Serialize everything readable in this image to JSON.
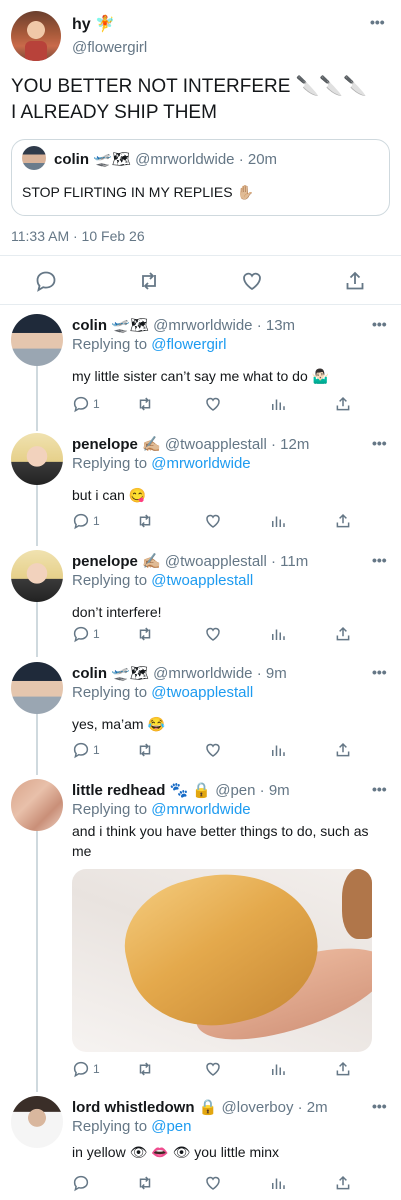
{
  "main_tweet": {
    "name": "hy",
    "name_emoji": "🧚",
    "handle": "@flowergirl",
    "more": "•••",
    "text": "YOU BETTER NOT INTERFERE 🔪🔪🔪\nI ALREADY SHIP THEM",
    "quote": {
      "name": "colin",
      "name_emoji": "🛫🗺",
      "handle": "@mrworldwide",
      "time": "· 20m",
      "text": "STOP FLIRTING IN MY REPLIES ✋🏼"
    },
    "timestamp": "11:33 AM · 10 Feb 26"
  },
  "replies": [
    {
      "name": "colin",
      "name_emoji": "🛫🗺",
      "handle": "@mrworldwide",
      "time": "· 13m",
      "replying_label": "Replying to",
      "replying_to": "@flowergirl",
      "text": "my little sister can’t say me what to do 🤷🏻‍♂️",
      "reply_count": "1",
      "more": "•••"
    },
    {
      "name": "penelope",
      "name_emoji": "✍🏼",
      "handle": "@twoapplestall",
      "time": "· 12m",
      "replying_label": "Replying to",
      "replying_to": "@mrworldwide",
      "text": "but i can 😋",
      "reply_count": "1",
      "more": "•••"
    },
    {
      "name": "penelope",
      "name_emoji": "✍🏼",
      "handle": "@twoapplestall",
      "time": "· 11m",
      "replying_label": "Replying to",
      "replying_to": "@twoapplestall",
      "text": "don’t interfere!",
      "reply_count": "1",
      "more": "•••"
    },
    {
      "name": "colin",
      "name_emoji": "🛫🗺",
      "handle": "@mrworldwide",
      "time": "· 9m",
      "replying_label": "Replying to",
      "replying_to": "@twoapplestall",
      "text": "yes, ma’am 😂",
      "reply_count": "1",
      "more": "•••"
    },
    {
      "name": "little redhead",
      "name_emoji": "🐾 🔒",
      "handle": "@pen",
      "time": "· 9m",
      "replying_label": "Replying to",
      "replying_to": "@mrworldwide",
      "text": "and i think you have better things to do, such as me",
      "reply_count": "1",
      "more": "•••"
    },
    {
      "name": "lord whistledown",
      "name_emoji": "🔒",
      "handle": "@loverboy",
      "time": "· 2m",
      "replying_label": "Replying to",
      "replying_to": "@pen",
      "text": "in yellow 👁 👄 👁  you little minx",
      "reply_count": "",
      "more": "•••"
    }
  ],
  "icons": [
    "reply-icon",
    "retweet-icon",
    "like-icon",
    "analytics-icon",
    "share-icon",
    "more-icon"
  ],
  "colors": {
    "link": "#1d9bf0",
    "secondary": "#657786",
    "divider": "#e6ecf0"
  }
}
